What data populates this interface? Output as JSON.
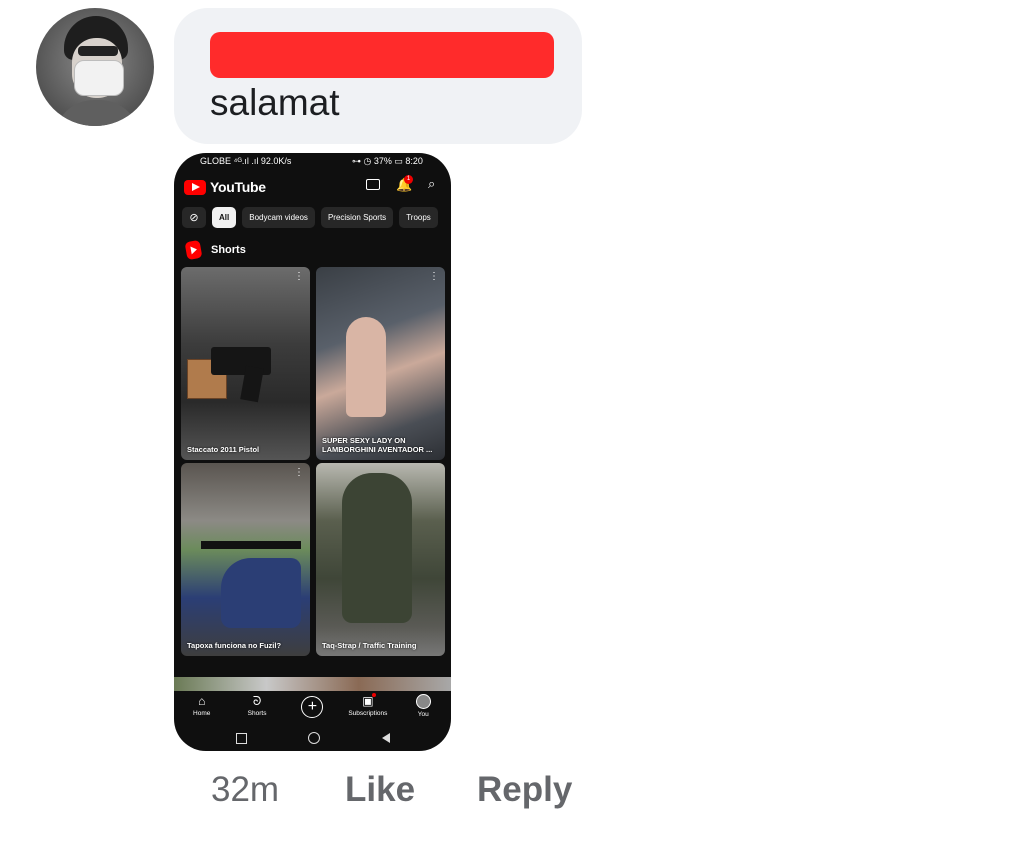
{
  "comment": {
    "text": "salamat",
    "time": "32m",
    "actions": {
      "like": "Like",
      "reply": "Reply"
    }
  },
  "phone_screenshot": {
    "status": {
      "left": "GLOBE ⁴ᴳ.ıl .ıl 92.0K/s",
      "right": "⊶ ◷ 37% ▭ 8:20"
    },
    "app_name": "YouTube",
    "notification_count": "1",
    "chips": [
      "All",
      "Bodycam videos",
      "Precision Sports",
      "Troops"
    ],
    "section_title": "Shorts",
    "shorts": [
      {
        "caption": "Staccato 2011 Pistol"
      },
      {
        "caption": "SUPER SEXY LADY ON LAMBORGHINI AVENTADOR ..."
      },
      {
        "caption": "Tapoxa funciona no Fuzil?"
      },
      {
        "caption": "Taq-Strap / Traffic Training"
      }
    ],
    "nav": [
      {
        "label": "Home",
        "icon": "home-icon"
      },
      {
        "label": "Shorts",
        "icon": "shorts-icon"
      },
      {
        "label": "",
        "icon": "create-icon"
      },
      {
        "label": "Subscriptions",
        "icon": "subscriptions-icon"
      },
      {
        "label": "You",
        "icon": "you-avatar-icon"
      }
    ]
  },
  "colors": {
    "bubble": "#f0f2f5",
    "redaction": "#ff2b2b",
    "youtube_red": "#ff0000",
    "meta_text": "#65676b"
  }
}
